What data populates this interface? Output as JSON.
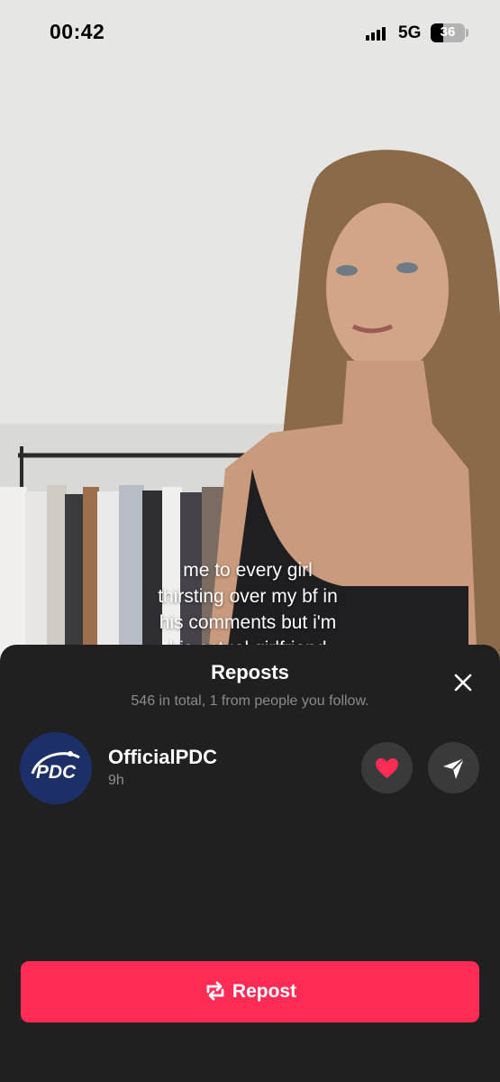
{
  "status_bar": {
    "time": "00:42",
    "network": "5G",
    "battery_level": "36",
    "signal_bars": 3
  },
  "video": {
    "caption_lines": [
      "me to every girl",
      "thirsting over my bf in",
      "his comments but i'm",
      "his actual girlfriend"
    ]
  },
  "sheet": {
    "title": "Reposts",
    "subtitle": "546 in total, 1 from people you follow.",
    "close_icon": "close-icon",
    "users": [
      {
        "name": "OfficialPDC",
        "time": "9h",
        "avatar_text": "PDC",
        "avatar_color": "#1c2f66",
        "like_icon": "heart-icon",
        "send_icon": "send-icon"
      }
    ],
    "repost_button": {
      "label": "Repost",
      "icon": "repost-icon",
      "color": "#fe2c55"
    }
  },
  "colors": {
    "sheet_bg": "#202020",
    "accent": "#fe2c55",
    "heart": "#fe2c55"
  }
}
